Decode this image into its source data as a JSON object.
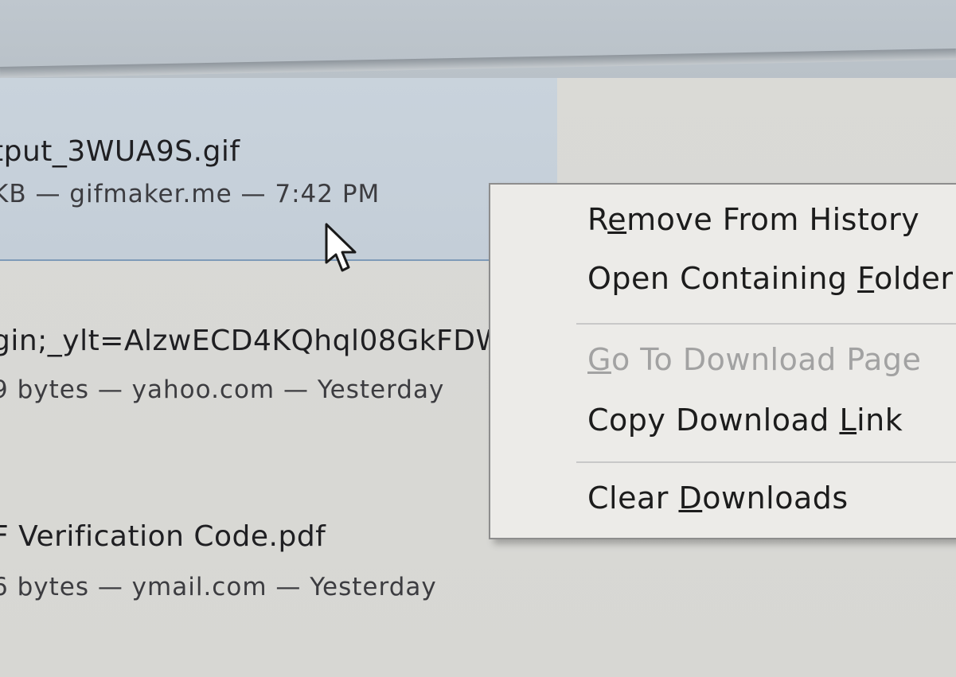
{
  "downloads": [
    {
      "name": "tput_3WUA9S.gif",
      "meta": "KB — gifmaker.me — 7:42 PM",
      "selected": true
    },
    {
      "name": "gin;_ylt=AlzwECD4KQhql08GkFDW",
      "meta": "9 bytes — yahoo.com — Yesterday",
      "selected": false
    },
    {
      "name": "F Verification Code.pdf",
      "meta": "6 bytes — ymail.com — Yesterday",
      "selected": false
    }
  ],
  "context_menu": {
    "items": [
      {
        "pre": "R",
        "ul": "e",
        "post": "move From History",
        "enabled": true
      },
      {
        "pre": "Open Containing ",
        "ul": "F",
        "post": "older",
        "enabled": true
      },
      {
        "pre": "",
        "ul": "G",
        "post": "o To Download Page",
        "enabled": false
      },
      {
        "pre": "Copy Download ",
        "ul": "L",
        "post": "ink",
        "enabled": true
      },
      {
        "pre": "Clear ",
        "ul": "D",
        "post": "ownloads",
        "enabled": true
      }
    ]
  },
  "cursor_icon": "arrow-cursor-icon"
}
